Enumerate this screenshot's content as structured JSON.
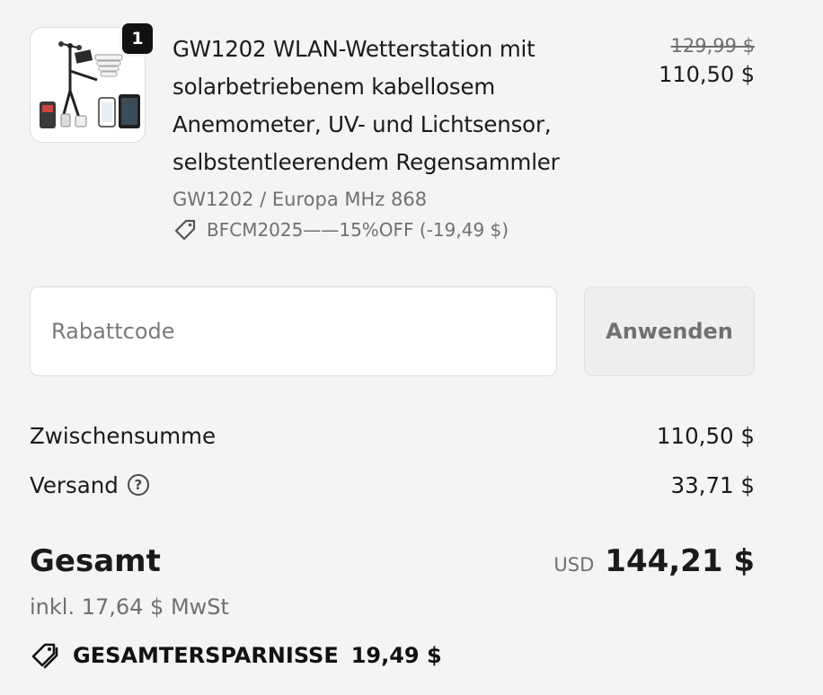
{
  "cart": {
    "item": {
      "quantity": "1",
      "title": "GW1202 WLAN-Wetterstation mit solarbetriebenem kabellosem Anemometer, UV- und Lichtsensor, selbstentleerendem Regensammler",
      "title_lines": [
        "GW1202 WLAN-Wetterstation mit",
        "solarbetriebenem kabellosem",
        "Anemometer, UV- und Lichtsensor,",
        "selbstentleerendem Regensammler"
      ],
      "variant": "GW1202 / Europa MHz 868",
      "discount_label": "BFCM2025——15%OFF (-19,49 $)",
      "price_original": "129,99 $",
      "price_current": "110,50 $",
      "image_icon": "weather-station-product-image"
    }
  },
  "discount": {
    "placeholder": "Rabattcode",
    "value": "",
    "apply_label": "Anwenden"
  },
  "summary": {
    "subtotal_label": "Zwischensumme",
    "subtotal_value": "110,50 $",
    "shipping_label": "Versand",
    "shipping_help_icon": "question-circle-icon",
    "shipping_value": "33,71 $",
    "total_label": "Gesamt",
    "currency": "USD",
    "total_value": "144,21 $",
    "tax_note": "inkl. 17,64 $ MwSt",
    "savings_label": "GESAMTERSPARNISSE",
    "savings_value": "19,49 $"
  },
  "colors": {
    "background": "#f4f4f4",
    "text": "#1a1a1a",
    "muted": "#707070",
    "badge": "#111111"
  }
}
